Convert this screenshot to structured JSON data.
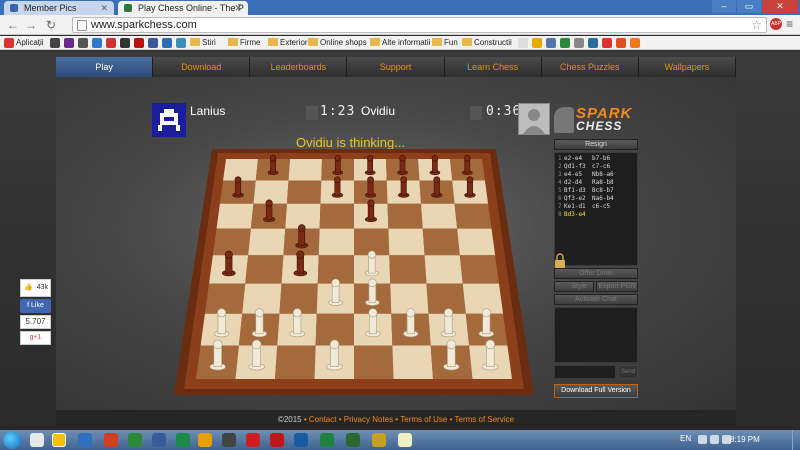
{
  "browser": {
    "tabs": [
      {
        "label": "Member Pics",
        "active": false
      },
      {
        "label": "Play Chess Online - The P",
        "active": true
      }
    ],
    "url": "www.sparkchess.com",
    "ext_badge": "ABP",
    "bookmarks": [
      "Aplicații",
      "Stiri",
      "Firme",
      "Exterior",
      "Online shops",
      "Alte informatii",
      "Fun",
      "Constructii"
    ]
  },
  "site": {
    "nav": [
      "Play",
      "Download",
      "Leaderboards",
      "Support",
      "Learn Chess",
      "Chess Puzzles",
      "Wallpapers"
    ],
    "active_nav": "Play",
    "player1": {
      "name": "Lanius",
      "clock": "1:23"
    },
    "player2": {
      "name": "Ovidiu",
      "clock": "0:36"
    },
    "status": "Ovidiu is thinking...",
    "logo": {
      "line1": "SPARK",
      "line2": "CHESS"
    },
    "resign": "Resign",
    "moves": [
      {
        "n": "1",
        "w": "e2-e4",
        "b": "b7-b6"
      },
      {
        "n": "2",
        "w": "Qd1-f3",
        "b": "c7-c6"
      },
      {
        "n": "3",
        "w": "e4-e5",
        "b": "Nb8-a6"
      },
      {
        "n": "4",
        "w": "d2-d4",
        "b": "Ra8-b8"
      },
      {
        "n": "5",
        "w": "Bf1-d3",
        "b": "Bc8-b7"
      },
      {
        "n": "6",
        "w": "Qf3-e2",
        "b": "Na6-b4"
      },
      {
        "n": "7",
        "w": "Ke1-d1",
        "b": "c6-c5"
      },
      {
        "n": "8",
        "w": "Bd3-e4",
        "b": ""
      }
    ],
    "offer_draw": "Offer Draw",
    "style": "Style",
    "export_pgn": "Export PGN",
    "activate_chat": "Activate Chat",
    "send": "Send",
    "download_full": "Download Full Version",
    "footer": {
      "copyright": "©2015",
      "links": [
        "Contact",
        "Privacy Notes",
        "Terms of Use",
        "Terms of Service"
      ]
    }
  },
  "social": {
    "likes": "43k",
    "like_label": "Like",
    "count": "5.707",
    "gplus": "g+1"
  },
  "taskbar": {
    "lang": "EN",
    "time": "8:19 PM"
  },
  "colors": {
    "accent": "#f08a1c",
    "active_nav": "#3b5c8f",
    "status": "#f0c419"
  }
}
